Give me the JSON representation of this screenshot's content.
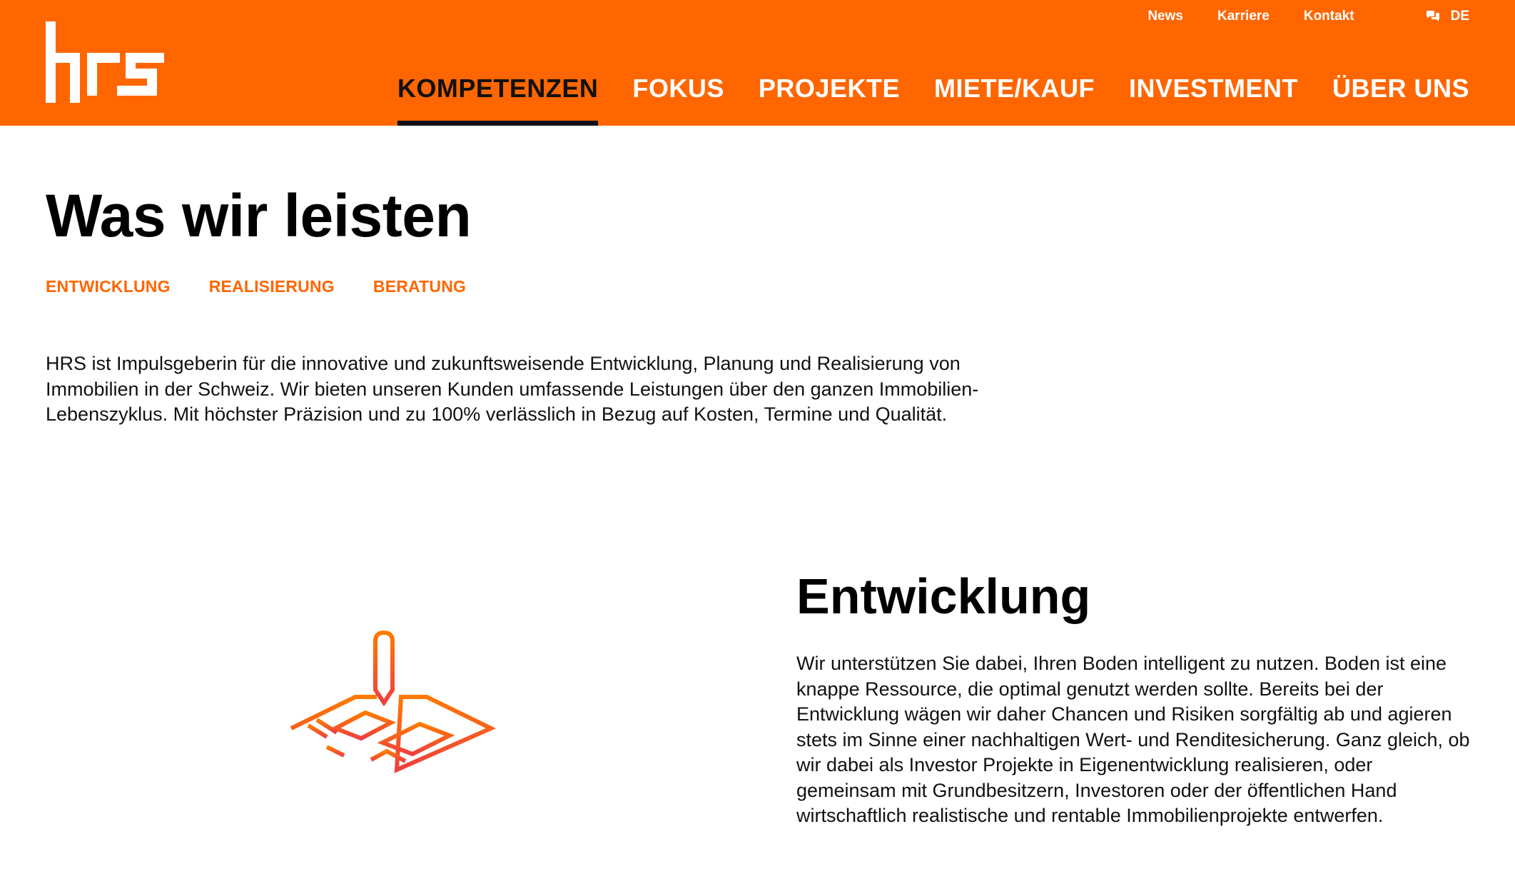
{
  "header": {
    "logo_alt": "hrs",
    "meta_nav": [
      "News",
      "Karriere",
      "Kontakt"
    ],
    "language": "DE",
    "language_icon": "chat-bubbles-icon",
    "main_nav": [
      {
        "label": "KOMPETENZEN",
        "active": true
      },
      {
        "label": "FOKUS",
        "active": false
      },
      {
        "label": "PROJEKTE",
        "active": false
      },
      {
        "label": "MIETE/KAUF",
        "active": false
      },
      {
        "label": "INVESTMENT",
        "active": false
      },
      {
        "label": "ÜBER UNS",
        "active": false
      }
    ]
  },
  "intro": {
    "title": "Was wir leisten",
    "sub_nav": [
      "ENTWICKLUNG",
      "REALISIERUNG",
      "BERATUNG"
    ],
    "text": "HRS ist Impulsgeberin für die innovative und zukunftsweisende Entwicklung, Planung und Realisierung von Immobilien in der Schweiz. Wir bieten unseren Kunden umfassende Leistungen über den ganzen Immobilien-Lebenszyklus. Mit höchster Präzision und zu 100% verlässlich in Bezug auf Kosten, Termine und Qualität."
  },
  "section": {
    "icon": "pencil-on-plan-icon",
    "title": "Entwicklung",
    "text": "Wir unterstützen Sie dabei, Ihren Boden intelligent zu nutzen. Boden ist eine knappe Ressource, die optimal genutzt werden sollte. Bereits bei der Entwicklung wägen wir daher Chancen und Risiken sorgfältig ab und agieren stets im Sinne einer nachhaltigen Wert- und Renditesicherung. Ganz gleich, ob wir dabei als Investor Projekte in Eigenentwicklung realisieren, oder gemeinsam mit Grundbesitzern, Investoren oder der öffentlichen Hand wirtschaftlich realistische und rentable Immobilienprojekte entwerfen."
  },
  "colors": {
    "brand_orange": "#ff6600",
    "active_nav": "#111111",
    "icon_gradient_start": "#ff7a00",
    "icon_gradient_end": "#ef3f3f"
  }
}
